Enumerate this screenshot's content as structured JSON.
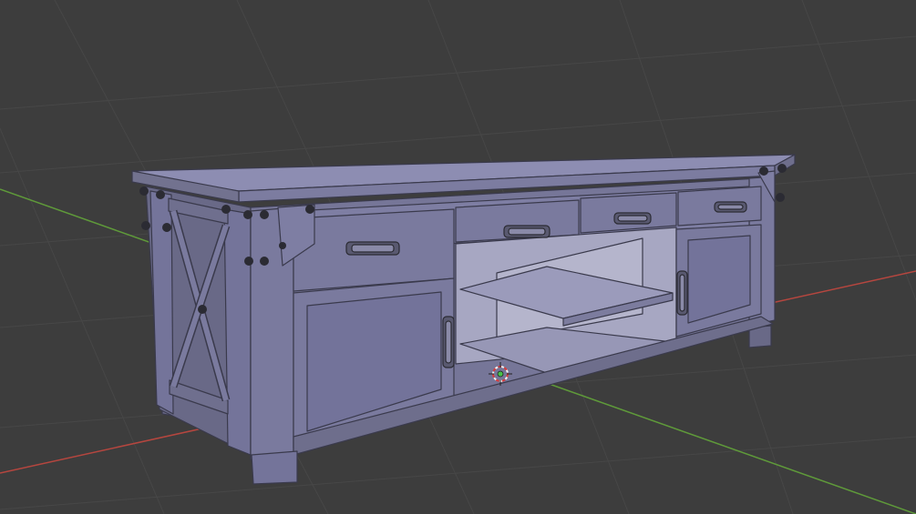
{
  "scene": {
    "object": "tv-console-cabinet",
    "view": "3d-viewport-solid-shading",
    "colors": {
      "background": "#3d3d3d",
      "grid": "#474747",
      "x_axis": "#b5463f",
      "y_axis": "#5f9a3a",
      "body": "#7a7a9e",
      "top_face": "#8d8db2",
      "front_face": "#767698",
      "side_face": "#696987",
      "interior": "#b0b0c8",
      "edge": "#3a3a4c",
      "bolt": "#2b2b33",
      "cursor_red": "#d83c3c",
      "cursor_white": "#f0f0f0",
      "origin_green": "#49c24a"
    }
  }
}
